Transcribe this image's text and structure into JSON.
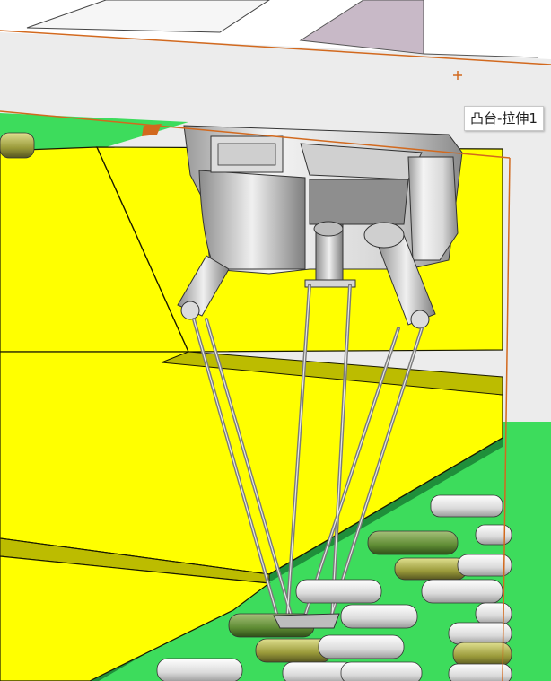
{
  "viewport": {
    "tooltip": "凸台-拉伸1"
  },
  "colors": {
    "background": "#ececec",
    "sketch_edge": "#d2691e",
    "platform": "#ffff00",
    "platform_edge": "#1a1a00",
    "conveyor": "#3ddc5c",
    "robot_housing": "#c9c9c9",
    "bottle_white": "#e6e6e6",
    "bottle_green": "#4f7f2e"
  },
  "icons": [
    "origin-marker-icon"
  ]
}
